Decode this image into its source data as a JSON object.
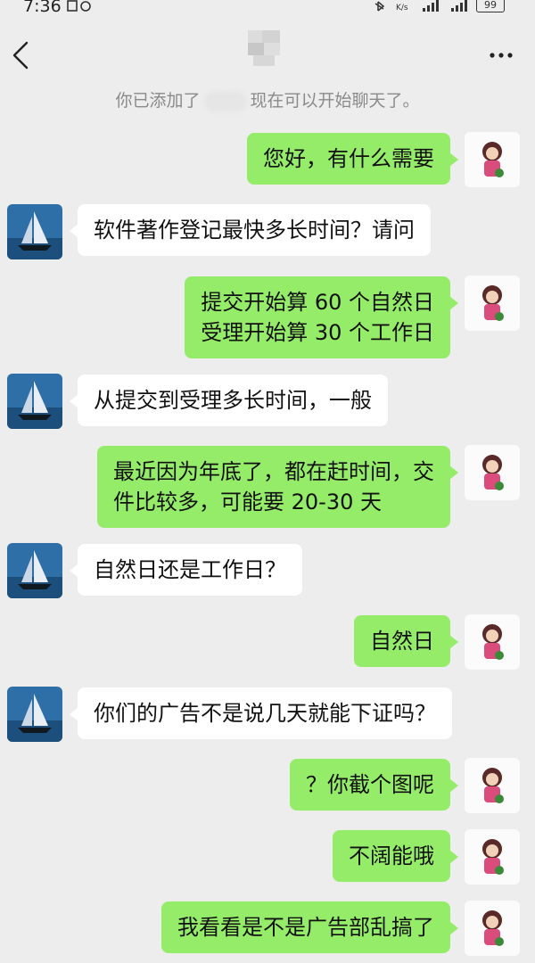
{
  "status_bar": {
    "time": "7:36",
    "battery": "99"
  },
  "header": {
    "back_icon": "chevron-left-icon",
    "more_icon": "more-dots-icon"
  },
  "system_message": {
    "prefix": "你已添加了",
    "suffix": "现在可以开始聊天了。"
  },
  "messages": [
    {
      "sender": "me",
      "lines": [
        "您好，有什么需要"
      ]
    },
    {
      "sender": "them",
      "lines": [
        "软件著作登记最快多长时间？请问"
      ]
    },
    {
      "sender": "me",
      "lines": [
        "提交开始算 60 个自然日",
        "受理开始算 30 个工作日"
      ]
    },
    {
      "sender": "them",
      "lines": [
        "从提交到受理多长时间，一般"
      ]
    },
    {
      "sender": "me",
      "lines": [
        "最近因为年底了，都在赶时间，交",
        "件比较多，可能要 20-30 天"
      ]
    },
    {
      "sender": "them",
      "lines": [
        "自然日还是工作日？"
      ]
    },
    {
      "sender": "me",
      "lines": [
        "自然日"
      ]
    },
    {
      "sender": "them",
      "lines": [
        "你们的广告不是说几天就能下证吗？"
      ]
    },
    {
      "sender": "me",
      "lines": [
        "？你截个图呢"
      ]
    },
    {
      "sender": "me",
      "lines": [
        "不阔能哦"
      ]
    },
    {
      "sender": "me",
      "lines": [
        "我看看是不是广告部乱搞了"
      ]
    }
  ],
  "colors": {
    "background": "#ededed",
    "my_bubble": "#95ec69",
    "their_bubble": "#ffffff"
  }
}
